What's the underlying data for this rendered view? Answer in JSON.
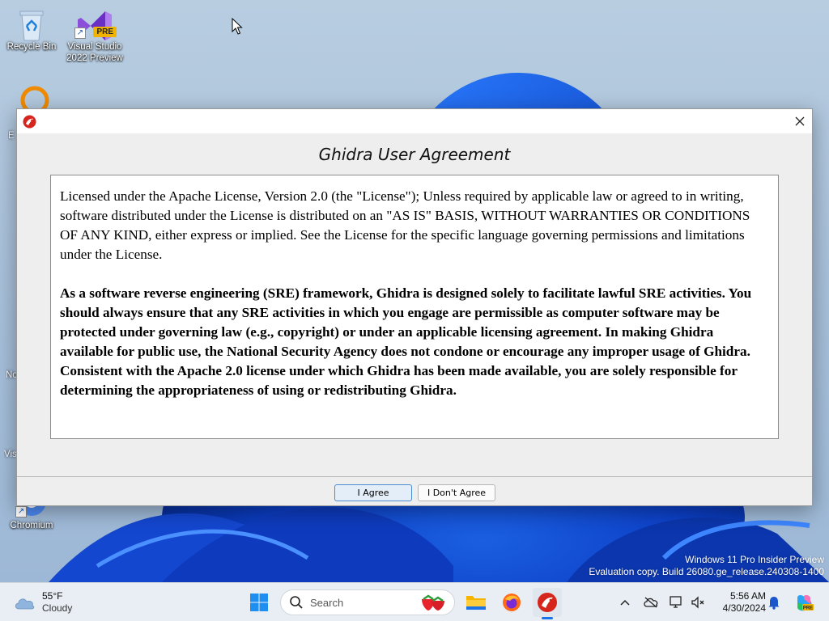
{
  "desktop": {
    "icons": [
      {
        "label": "Recycle Bin"
      },
      {
        "label": "Visual Studio 2022 Preview",
        "badge": "PRE"
      },
      {
        "label": "Chromium"
      }
    ],
    "partial_labels": [
      "E",
      "No",
      "Vis"
    ]
  },
  "dialog": {
    "title": "Ghidra User Agreement",
    "license_paragraph": "Licensed under the Apache License, Version 2.0 (the \"License\"); Unless required by applicable law or agreed to in writing, software distributed under the License is distributed on an \"AS IS\" BASIS, WITHOUT WARRANTIES OR CONDITIONS OF ANY KIND, either express or implied. See the License for the specific language governing permissions and limitations under the License.",
    "sre_paragraph": "As a software reverse engineering (SRE) framework, Ghidra is designed solely to facilitate lawful SRE activities. You should always ensure that any SRE activities in which you engage are permissible as computer software may be protected under governing law (e.g., copyright) or under an applicable licensing agreement. In making Ghidra available for public use, the National Security Agency does not condone or encourage any improper usage of Ghidra. Consistent with the Apache 2.0 license under which Ghidra has been made available, you are solely responsible for determining the appropriateness of using or redistributing Ghidra.",
    "agree_label": "I Agree",
    "disagree_label": "I Don't Agree",
    "close_icon": "close-icon"
  },
  "watermark": {
    "line1": "Windows 11 Pro Insider Preview",
    "line2": "Evaluation copy. Build 26080.ge_release.240308-1400"
  },
  "taskbar": {
    "weather": {
      "temp": "55°F",
      "condition": "Cloudy"
    },
    "search_placeholder": "Search",
    "clock": {
      "time": "5:56 AM",
      "date": "4/30/2024"
    },
    "colors": {
      "accent": "#1a73e8",
      "taskbar_bg": "#e9eef4"
    }
  }
}
